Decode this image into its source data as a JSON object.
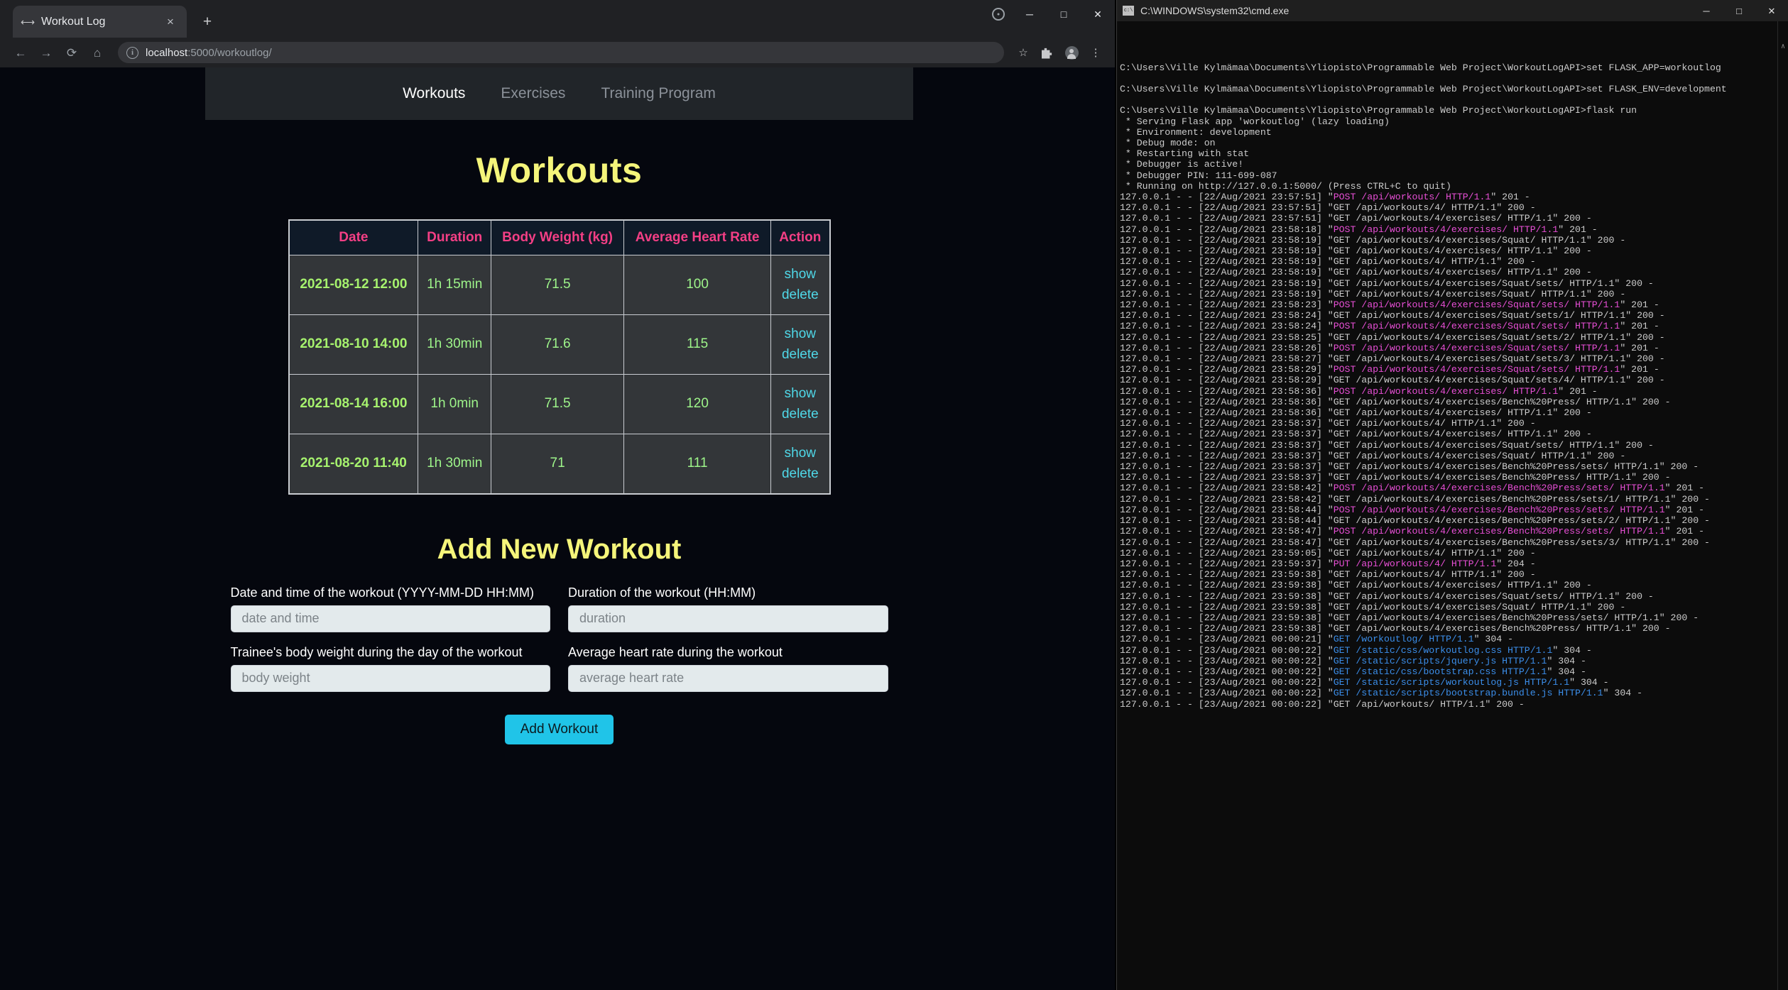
{
  "browser": {
    "tab": {
      "title": "Workout Log",
      "favicon_icon": "link-icon",
      "close_icon": "×"
    },
    "new_tab_icon": "+",
    "window_controls": {
      "extra_icon": "⊙",
      "minimize": "─",
      "maximize": "□",
      "close": "✕"
    },
    "nav": {
      "back_icon": "←",
      "forward_icon": "→",
      "reload_icon": "⟳",
      "home_icon": "⌂"
    },
    "omnibox": {
      "info_icon": "i",
      "url_host": "localhost",
      "url_rest": ":5000/workoutlog/",
      "star_icon": "☆",
      "extensions_icon": "puzzle-icon",
      "profile_icon": "avatar-icon",
      "menu_icon": "⋮"
    }
  },
  "page": {
    "nav": [
      {
        "label": "Workouts",
        "active": true
      },
      {
        "label": "Exercises",
        "active": false
      },
      {
        "label": "Training Program",
        "active": false
      }
    ],
    "title": "Workouts",
    "table": {
      "headers": [
        "Date",
        "Duration",
        "Body Weight (kg)",
        "Average Heart Rate",
        "Action"
      ],
      "rows": [
        {
          "date": "2021-08-12 12:00",
          "duration": "1h 15min",
          "weight": "71.5",
          "hr": "100",
          "show": "show",
          "delete": "delete"
        },
        {
          "date": "2021-08-10 14:00",
          "duration": "1h 30min",
          "weight": "71.6",
          "hr": "115",
          "show": "show",
          "delete": "delete"
        },
        {
          "date": "2021-08-14 16:00",
          "duration": "1h 0min",
          "weight": "71.5",
          "hr": "120",
          "show": "show",
          "delete": "delete"
        },
        {
          "date": "2021-08-20 11:40",
          "duration": "1h 30min",
          "weight": "71",
          "hr": "111",
          "show": "show",
          "delete": "delete"
        }
      ]
    },
    "form": {
      "title": "Add New Workout",
      "fields": [
        {
          "label": "Date and time of the workout (YYYY-MM-DD HH:MM)",
          "placeholder": "date and time",
          "value": ""
        },
        {
          "label": "Duration of the workout (HH:MM)",
          "placeholder": "duration",
          "value": ""
        },
        {
          "label": "Trainee's body weight during the day of the workout",
          "placeholder": "body weight",
          "value": ""
        },
        {
          "label": "Average heart rate during the workout",
          "placeholder": "average heart rate",
          "value": ""
        }
      ],
      "submit_label": "Add Workout"
    },
    "colors": {
      "heading": "#f5f57a",
      "table_header_text": "#f43f85",
      "table_cell_text": "#9ef58a",
      "action_link": "#4fd8e8",
      "submit_bg": "#20c4e8"
    }
  },
  "terminal": {
    "title": "C:\\WINDOWS\\system32\\cmd.exe",
    "window_controls": {
      "minimize": "─",
      "maximize": "□",
      "close": "✕"
    },
    "scroll_up_arrow": "∧",
    "scroll_down_arrow": "∨",
    "lines": [
      {
        "t": "blank"
      },
      {
        "t": "plain",
        "text": "C:\\Users\\Ville Kylmämaa\\Documents\\Yliopisto\\Programmable Web Project\\WorkoutLogAPI>set FLASK_APP=workoutlog"
      },
      {
        "t": "blank"
      },
      {
        "t": "plain",
        "text": "C:\\Users\\Ville Kylmämaa\\Documents\\Yliopisto\\Programmable Web Project\\WorkoutLogAPI>set FLASK_ENV=development"
      },
      {
        "t": "blank"
      },
      {
        "t": "plain",
        "text": "C:\\Users\\Ville Kylmämaa\\Documents\\Yliopisto\\Programmable Web Project\\WorkoutLogAPI>flask run"
      },
      {
        "t": "plain",
        "text": " * Serving Flask app 'workoutlog' (lazy loading)"
      },
      {
        "t": "plain",
        "text": " * Environment: development"
      },
      {
        "t": "plain",
        "text": " * Debug mode: on"
      },
      {
        "t": "plain",
        "text": " * Restarting with stat"
      },
      {
        "t": "plain",
        "text": " * Debugger is active!"
      },
      {
        "t": "plain",
        "text": " * Debugger PIN: 111-699-087"
      },
      {
        "t": "plain",
        "text": " * Running on http://127.0.0.1:5000/ (Press CTRL+C to quit)"
      },
      {
        "t": "req",
        "pre": "127.0.0.1 - - [22/Aug/2021 23:57:51] \"",
        "hl": "POST /api/workouts/ HTTP/1.1",
        "color": "m",
        "post": "\" 201 -"
      },
      {
        "t": "plain",
        "text": "127.0.0.1 - - [22/Aug/2021 23:57:51] \"GET /api/workouts/4/ HTTP/1.1\" 200 -"
      },
      {
        "t": "plain",
        "text": "127.0.0.1 - - [22/Aug/2021 23:57:51] \"GET /api/workouts/4/exercises/ HTTP/1.1\" 200 -"
      },
      {
        "t": "req",
        "pre": "127.0.0.1 - - [22/Aug/2021 23:58:18] \"",
        "hl": "POST /api/workouts/4/exercises/ HTTP/1.1",
        "color": "m",
        "post": "\" 201 -"
      },
      {
        "t": "plain",
        "text": "127.0.0.1 - - [22/Aug/2021 23:58:19] \"GET /api/workouts/4/exercises/Squat/ HTTP/1.1\" 200 -"
      },
      {
        "t": "plain",
        "text": "127.0.0.1 - - [22/Aug/2021 23:58:19] \"GET /api/workouts/4/exercises/ HTTP/1.1\" 200 -"
      },
      {
        "t": "plain",
        "text": "127.0.0.1 - - [22/Aug/2021 23:58:19] \"GET /api/workouts/4/ HTTP/1.1\" 200 -"
      },
      {
        "t": "plain",
        "text": "127.0.0.1 - - [22/Aug/2021 23:58:19] \"GET /api/workouts/4/exercises/ HTTP/1.1\" 200 -"
      },
      {
        "t": "plain",
        "text": "127.0.0.1 - - [22/Aug/2021 23:58:19] \"GET /api/workouts/4/exercises/Squat/sets/ HTTP/1.1\" 200 -"
      },
      {
        "t": "plain",
        "text": "127.0.0.1 - - [22/Aug/2021 23:58:19] \"GET /api/workouts/4/exercises/Squat/ HTTP/1.1\" 200 -"
      },
      {
        "t": "req",
        "pre": "127.0.0.1 - - [22/Aug/2021 23:58:23] \"",
        "hl": "POST /api/workouts/4/exercises/Squat/sets/ HTTP/1.1",
        "color": "m",
        "post": "\" 201 -"
      },
      {
        "t": "plain",
        "text": "127.0.0.1 - - [22/Aug/2021 23:58:24] \"GET /api/workouts/4/exercises/Squat/sets/1/ HTTP/1.1\" 200 -"
      },
      {
        "t": "req",
        "pre": "127.0.0.1 - - [22/Aug/2021 23:58:24] \"",
        "hl": "POST /api/workouts/4/exercises/Squat/sets/ HTTP/1.1",
        "color": "m",
        "post": "\" 201 -"
      },
      {
        "t": "plain",
        "text": "127.0.0.1 - - [22/Aug/2021 23:58:25] \"GET /api/workouts/4/exercises/Squat/sets/2/ HTTP/1.1\" 200 -"
      },
      {
        "t": "req",
        "pre": "127.0.0.1 - - [22/Aug/2021 23:58:26] \"",
        "hl": "POST /api/workouts/4/exercises/Squat/sets/ HTTP/1.1",
        "color": "m",
        "post": "\" 201 -"
      },
      {
        "t": "plain",
        "text": "127.0.0.1 - - [22/Aug/2021 23:58:27] \"GET /api/workouts/4/exercises/Squat/sets/3/ HTTP/1.1\" 200 -"
      },
      {
        "t": "req",
        "pre": "127.0.0.1 - - [22/Aug/2021 23:58:29] \"",
        "hl": "POST /api/workouts/4/exercises/Squat/sets/ HTTP/1.1",
        "color": "m",
        "post": "\" 201 -"
      },
      {
        "t": "plain",
        "text": "127.0.0.1 - - [22/Aug/2021 23:58:29] \"GET /api/workouts/4/exercises/Squat/sets/4/ HTTP/1.1\" 200 -"
      },
      {
        "t": "req",
        "pre": "127.0.0.1 - - [22/Aug/2021 23:58:36] \"",
        "hl": "POST /api/workouts/4/exercises/ HTTP/1.1",
        "color": "m",
        "post": "\" 201 -"
      },
      {
        "t": "plain",
        "text": "127.0.0.1 - - [22/Aug/2021 23:58:36] \"GET /api/workouts/4/exercises/Bench%20Press/ HTTP/1.1\" 200 -"
      },
      {
        "t": "plain",
        "text": "127.0.0.1 - - [22/Aug/2021 23:58:36] \"GET /api/workouts/4/exercises/ HTTP/1.1\" 200 -"
      },
      {
        "t": "plain",
        "text": "127.0.0.1 - - [22/Aug/2021 23:58:37] \"GET /api/workouts/4/ HTTP/1.1\" 200 -"
      },
      {
        "t": "plain",
        "text": "127.0.0.1 - - [22/Aug/2021 23:58:37] \"GET /api/workouts/4/exercises/ HTTP/1.1\" 200 -"
      },
      {
        "t": "plain",
        "text": "127.0.0.1 - - [22/Aug/2021 23:58:37] \"GET /api/workouts/4/exercises/Squat/sets/ HTTP/1.1\" 200 -"
      },
      {
        "t": "plain",
        "text": "127.0.0.1 - - [22/Aug/2021 23:58:37] \"GET /api/workouts/4/exercises/Squat/ HTTP/1.1\" 200 -"
      },
      {
        "t": "plain",
        "text": "127.0.0.1 - - [22/Aug/2021 23:58:37] \"GET /api/workouts/4/exercises/Bench%20Press/sets/ HTTP/1.1\" 200 -"
      },
      {
        "t": "plain",
        "text": "127.0.0.1 - - [22/Aug/2021 23:58:37] \"GET /api/workouts/4/exercises/Bench%20Press/ HTTP/1.1\" 200 -"
      },
      {
        "t": "req",
        "pre": "127.0.0.1 - - [22/Aug/2021 23:58:42] \"",
        "hl": "POST /api/workouts/4/exercises/Bench%20Press/sets/ HTTP/1.1",
        "color": "m",
        "post": "\" 201 -"
      },
      {
        "t": "plain",
        "text": "127.0.0.1 - - [22/Aug/2021 23:58:42] \"GET /api/workouts/4/exercises/Bench%20Press/sets/1/ HTTP/1.1\" 200 -"
      },
      {
        "t": "req",
        "pre": "127.0.0.1 - - [22/Aug/2021 23:58:44] \"",
        "hl": "POST /api/workouts/4/exercises/Bench%20Press/sets/ HTTP/1.1",
        "color": "m",
        "post": "\" 201 -"
      },
      {
        "t": "plain",
        "text": "127.0.0.1 - - [22/Aug/2021 23:58:44] \"GET /api/workouts/4/exercises/Bench%20Press/sets/2/ HTTP/1.1\" 200 -"
      },
      {
        "t": "req",
        "pre": "127.0.0.1 - - [22/Aug/2021 23:58:47] \"",
        "hl": "POST /api/workouts/4/exercises/Bench%20Press/sets/ HTTP/1.1",
        "color": "m",
        "post": "\" 201 -"
      },
      {
        "t": "plain",
        "text": "127.0.0.1 - - [22/Aug/2021 23:58:47] \"GET /api/workouts/4/exercises/Bench%20Press/sets/3/ HTTP/1.1\" 200 -"
      },
      {
        "t": "plain",
        "text": "127.0.0.1 - - [22/Aug/2021 23:59:05] \"GET /api/workouts/4/ HTTP/1.1\" 200 -"
      },
      {
        "t": "req",
        "pre": "127.0.0.1 - - [22/Aug/2021 23:59:37] \"",
        "hl": "PUT /api/workouts/4/ HTTP/1.1",
        "color": "m",
        "post": "\" 204 -"
      },
      {
        "t": "plain",
        "text": "127.0.0.1 - - [22/Aug/2021 23:59:38] \"GET /api/workouts/4/ HTTP/1.1\" 200 -"
      },
      {
        "t": "plain",
        "text": "127.0.0.1 - - [22/Aug/2021 23:59:38] \"GET /api/workouts/4/exercises/ HTTP/1.1\" 200 -"
      },
      {
        "t": "plain",
        "text": "127.0.0.1 - - [22/Aug/2021 23:59:38] \"GET /api/workouts/4/exercises/Squat/sets/ HTTP/1.1\" 200 -"
      },
      {
        "t": "plain",
        "text": "127.0.0.1 - - [22/Aug/2021 23:59:38] \"GET /api/workouts/4/exercises/Squat/ HTTP/1.1\" 200 -"
      },
      {
        "t": "plain",
        "text": "127.0.0.1 - - [22/Aug/2021 23:59:38] \"GET /api/workouts/4/exercises/Bench%20Press/sets/ HTTP/1.1\" 200 -"
      },
      {
        "t": "plain",
        "text": "127.0.0.1 - - [22/Aug/2021 23:59:38] \"GET /api/workouts/4/exercises/Bench%20Press/ HTTP/1.1\" 200 -"
      },
      {
        "t": "req",
        "pre": "127.0.0.1 - - [23/Aug/2021 00:00:21] \"",
        "hl": "GET /workoutlog/ HTTP/1.1",
        "color": "c",
        "post": "\" 304 -"
      },
      {
        "t": "req",
        "pre": "127.0.0.1 - - [23/Aug/2021 00:00:22] \"",
        "hl": "GET /static/css/workoutlog.css HTTP/1.1",
        "color": "c",
        "post": "\" 304 -"
      },
      {
        "t": "req",
        "pre": "127.0.0.1 - - [23/Aug/2021 00:00:22] \"",
        "hl": "GET /static/scripts/jquery.js HTTP/1.1",
        "color": "c",
        "post": "\" 304 -"
      },
      {
        "t": "req",
        "pre": "127.0.0.1 - - [23/Aug/2021 00:00:22] \"",
        "hl": "GET /static/css/bootstrap.css HTTP/1.1",
        "color": "c",
        "post": "\" 304 -"
      },
      {
        "t": "req",
        "pre": "127.0.0.1 - - [23/Aug/2021 00:00:22] \"",
        "hl": "GET /static/scripts/workoutlog.js HTTP/1.1",
        "color": "c",
        "post": "\" 304 -"
      },
      {
        "t": "req",
        "pre": "127.0.0.1 - - [23/Aug/2021 00:00:22] \"",
        "hl": "GET /static/scripts/bootstrap.bundle.js HTTP/1.1",
        "color": "c",
        "post": "\" 304 -"
      },
      {
        "t": "plain",
        "text": "127.0.0.1 - - [23/Aug/2021 00:00:22] \"GET /api/workouts/ HTTP/1.1\" 200 -"
      }
    ]
  }
}
